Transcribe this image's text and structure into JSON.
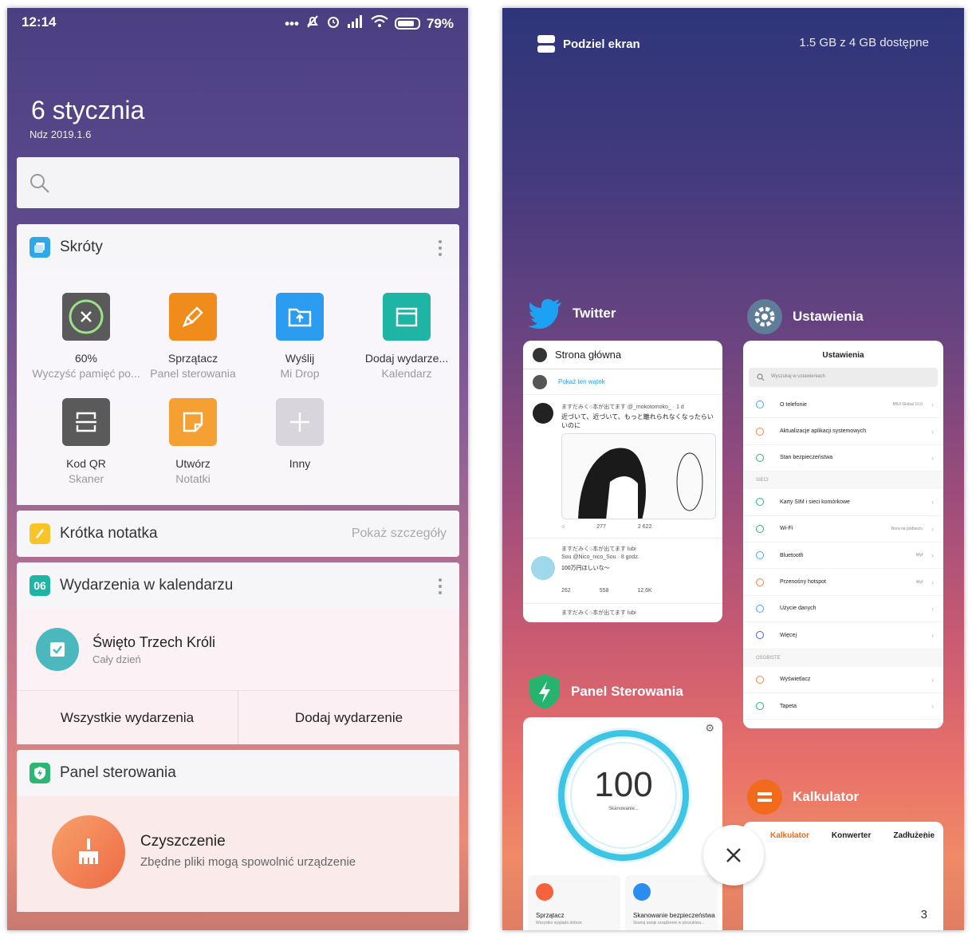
{
  "left": {
    "status": {
      "time": "12:14",
      "battery": "79%"
    },
    "date": {
      "big": "6 stycznia",
      "small": "Ndz 2019.1.6"
    },
    "shortcuts": {
      "title": "Skróty",
      "items": [
        {
          "line1": "60%",
          "line2": "Wyczyść pamięć po...",
          "icon": "memory-clean-icon",
          "color": "#5a5a5a"
        },
        {
          "line1": "Sprzątacz",
          "line2": "Panel sterowania",
          "icon": "broom-icon",
          "color": "#f08c1c"
        },
        {
          "line1": "Wyślij",
          "line2": "Mi Drop",
          "icon": "upload-folder-icon",
          "color": "#2b9cf0"
        },
        {
          "line1": "Dodaj wydarze...",
          "line2": "Kalendarz",
          "icon": "calendar-icon",
          "color": "#1fb5a5"
        },
        {
          "line1": "Kod QR",
          "line2": "Skaner",
          "icon": "qr-scan-icon",
          "color": "#5a5a5a"
        },
        {
          "line1": "Utwórz",
          "line2": "Notatki",
          "icon": "note-icon",
          "color": "#f5a033"
        },
        {
          "line1": "Inny",
          "line2": "",
          "icon": "plus-icon",
          "color": "#d8d6dc"
        }
      ]
    },
    "note": {
      "title": "Krótka notatka",
      "details": "Pokaż szczegóły"
    },
    "calendar": {
      "badge": "06",
      "title": "Wydarzenia w kalendarzu",
      "event_title": "Święto Trzech Króli",
      "event_time": "Cały dzień",
      "btn_all": "Wszystkie wydarzenia",
      "btn_add": "Dodaj wydarzenie"
    },
    "security": {
      "title": "Panel sterowania",
      "clean_title": "Czyszczenie",
      "clean_desc": "Zbędne pliki mogą spowolnić urządzenie"
    }
  },
  "right": {
    "split_label": "Podziel ekran",
    "memory": "1.5 GB z 4 GB dostępne",
    "twitter": {
      "label": "Twitter",
      "header": "Strona główna",
      "show_thread": "Pokaż ten wątek",
      "tweet1_author": "ますだみく○本が出てます @_mokotomoko_ · 1 d",
      "tweet1_text": "近づいて、近づいて、もっと離れられなくなったらいいのに",
      "tweet1_stats": [
        "277",
        "2 622"
      ],
      "tweet2_liked": "ますだみく○本が出てます lubi",
      "tweet2_author": "Sou @Nico_nico_Sou · 8 godz.",
      "tweet2_text": "100万円ほしいな〜",
      "tweet2_stats": [
        "262",
        "558",
        "12,6K"
      ],
      "tweet3_liked": "ますだみく○本が出てます lubi"
    },
    "settings": {
      "label": "Ustawienia",
      "title": "Ustawienia",
      "search": "Wyszukaj w ustawieniach",
      "rows1": [
        {
          "label": "O telefonie",
          "value": "MIUI Global 10.0"
        },
        {
          "label": "Aktualizacje aplikacji systemowych",
          "value": ""
        },
        {
          "label": "Stan bezpieczeństwa",
          "value": ""
        }
      ],
      "section2": "SIECI",
      "rows2": [
        {
          "label": "Karty SIM i sieci komórkowe",
          "value": ""
        },
        {
          "label": "Wi-Fi",
          "value": "Nora na podlaszu"
        },
        {
          "label": "Bluetooth",
          "value": "Wył"
        },
        {
          "label": "Przenośny hotspot",
          "value": "Wył"
        },
        {
          "label": "Użycie danych",
          "value": ""
        },
        {
          "label": "Więcej",
          "value": ""
        }
      ],
      "section3": "OSOBISTE",
      "rows3": [
        {
          "label": "Wyświetlacz",
          "value": ""
        },
        {
          "label": "Tapeta",
          "value": ""
        }
      ]
    },
    "panel": {
      "label": "Panel Sterowania",
      "score": "100",
      "scan": "Skanowanie...",
      "tile1_title": "Sprzątacz",
      "tile1_sub": "Wszystko wygląda dobrze",
      "tile2_title": "Skanowanie bezpieczeństwa",
      "tile2_sub": "Skanuj swoje urządzenie w poszukiwa..."
    },
    "calculator": {
      "label": "Kalkulator",
      "tabs": [
        "Kalkulator",
        "Konwerter",
        "Zadłużenie"
      ],
      "display": "3"
    }
  }
}
